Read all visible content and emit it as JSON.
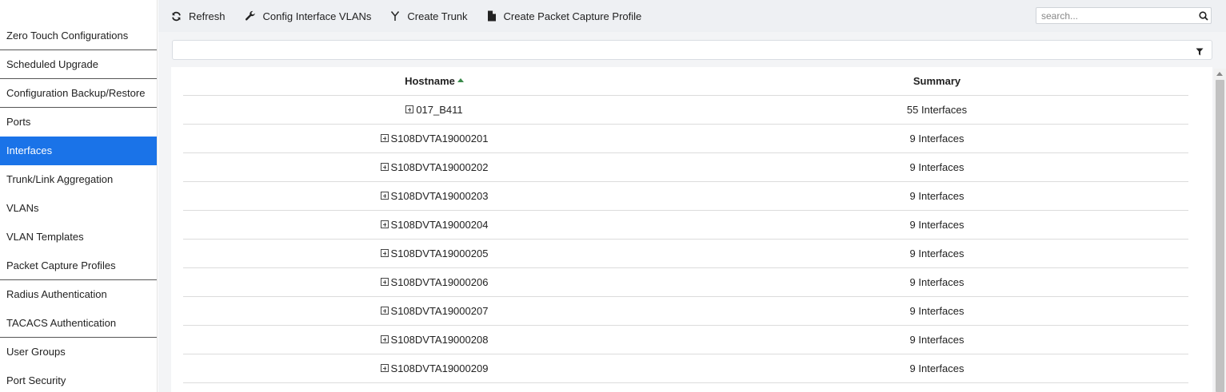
{
  "sidebar": {
    "items": [
      {
        "label": "Zero Touch Configurations"
      },
      {
        "label": "Scheduled Upgrade"
      },
      {
        "label": "Configuration Backup/Restore"
      },
      {
        "label": "Ports"
      },
      {
        "label": "Interfaces"
      },
      {
        "label": "Trunk/Link Aggregation"
      },
      {
        "label": "VLANs"
      },
      {
        "label": "VLAN Templates"
      },
      {
        "label": "Packet Capture Profiles"
      },
      {
        "label": "Radius Authentication"
      },
      {
        "label": "TACACS Authentication"
      },
      {
        "label": "User Groups"
      },
      {
        "label": "Port Security"
      }
    ],
    "active_label": "Interfaces",
    "active_color": "#1a73e8"
  },
  "toolbar": {
    "refresh_label": "Refresh",
    "config_vlans_label": "Config Interface VLANs",
    "create_trunk_label": "Create Trunk",
    "create_capture_label": "Create Packet Capture Profile",
    "icons": [
      "refresh-icon",
      "wrench-icon",
      "fork-icon",
      "file-icon",
      "search-icon",
      "filter-icon"
    ]
  },
  "search": {
    "placeholder": "search...",
    "value": ""
  },
  "table": {
    "columns": {
      "hostname": "Hostname",
      "summary": "Summary"
    },
    "sort": {
      "column": "hostname",
      "direction": "ascending"
    },
    "rows": [
      {
        "hostname": "017_B411",
        "summary": "55 Interfaces"
      },
      {
        "hostname": "S108DVTA19000201",
        "summary": "9 Interfaces"
      },
      {
        "hostname": "S108DVTA19000202",
        "summary": "9 Interfaces"
      },
      {
        "hostname": "S108DVTA19000203",
        "summary": "9 Interfaces"
      },
      {
        "hostname": "S108DVTA19000204",
        "summary": "9 Interfaces"
      },
      {
        "hostname": "S108DVTA19000205",
        "summary": "9 Interfaces"
      },
      {
        "hostname": "S108DVTA19000206",
        "summary": "9 Interfaces"
      },
      {
        "hostname": "S108DVTA19000207",
        "summary": "9 Interfaces"
      },
      {
        "hostname": "S108DVTA19000208",
        "summary": "9 Interfaces"
      },
      {
        "hostname": "S108DVTA19000209",
        "summary": "9 Interfaces"
      }
    ]
  }
}
